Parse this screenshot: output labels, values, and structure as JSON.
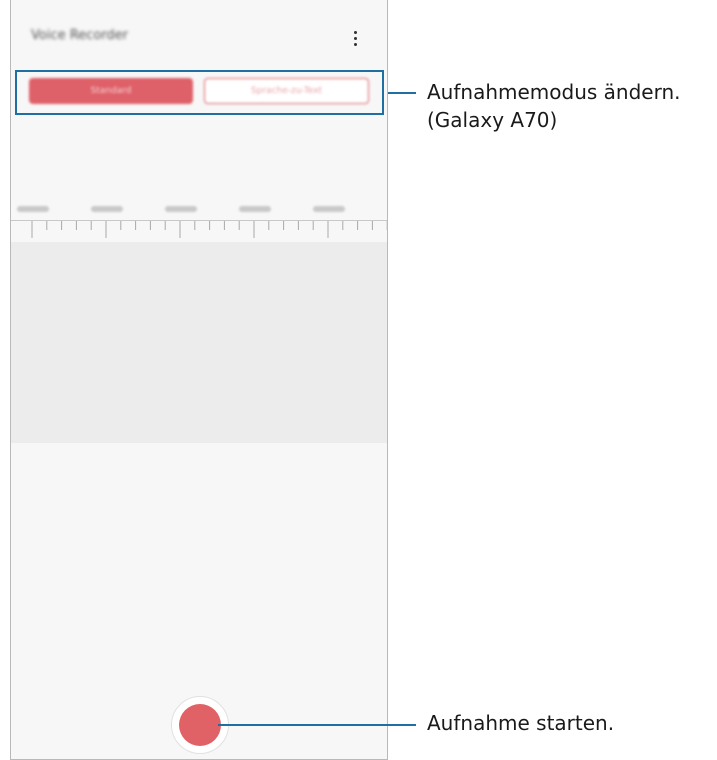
{
  "phone": {
    "app_title": "Voice Recorder",
    "more_icon": "more-vertical-icon",
    "modes": {
      "standard_label": "Standard",
      "speech_to_text_label": "Sprache-zu-Text"
    },
    "timeline_ticks": [
      "00:00",
      "00:05",
      "00:10",
      "00:15",
      "00:20"
    ],
    "record_button_icon": "record-icon"
  },
  "annotations": {
    "mode_change_line1": "Aufnahmemodus ändern.",
    "mode_change_line2": "(Galaxy A70)",
    "start_recording": "Aufnahme starten."
  },
  "colors": {
    "accent": "#de6068",
    "callout": "#1f6fa3",
    "waveform_bg": "#ececec"
  }
}
